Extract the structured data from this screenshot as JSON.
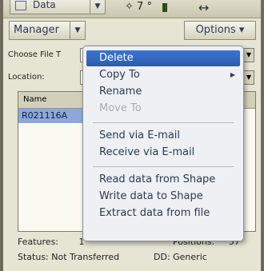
{
  "toolbar": {
    "data_dropdown_label": "Data",
    "sat_text": "7",
    "manager_label": "Manager",
    "options_label": "Options"
  },
  "form": {
    "choose_file_label": "Choose File T",
    "location_label": "Location:"
  },
  "file_list": {
    "header": "Name",
    "rows": [
      "R021116A"
    ]
  },
  "status": {
    "features_label": "Features:",
    "features_value": "1",
    "positions_label": "Positions:",
    "positions_value": "57",
    "status_text": "Status: Not Transferred",
    "dd_text": "DD: Generic"
  },
  "context_menu": {
    "items": [
      {
        "label": "Delete",
        "state": "selected"
      },
      {
        "label": "Copy To",
        "state": "normal",
        "submenu": true
      },
      {
        "label": "Rename",
        "state": "normal"
      },
      {
        "label": "Move To",
        "state": "disabled"
      },
      {
        "label": "Send via E-mail",
        "state": "normal"
      },
      {
        "label": "Receive via E-mail",
        "state": "normal"
      },
      {
        "label": "Read data from Shape",
        "state": "normal"
      },
      {
        "label": "Write data to Shape",
        "state": "normal"
      },
      {
        "label": "Extract data from file",
        "state": "normal"
      }
    ]
  },
  "colors": {
    "menu_highlight": "#2f63bd",
    "list_selection": "#8ea7d8",
    "background": "#e6e4d2"
  }
}
